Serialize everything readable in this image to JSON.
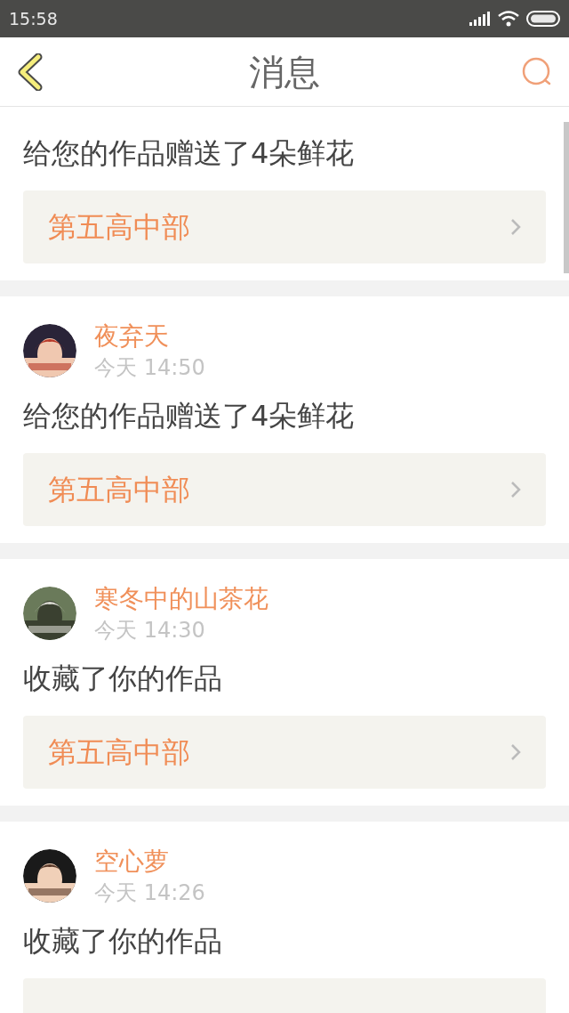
{
  "status_bar": {
    "time": "15:58"
  },
  "header": {
    "title": "消息"
  },
  "messages": [
    {
      "text": "给您的作品赠送了4朵鲜花",
      "link": "第五高中部"
    },
    {
      "author": "夜弃天",
      "time": "今天 14:50",
      "text": "给您的作品赠送了4朵鲜花",
      "link": "第五高中部"
    },
    {
      "author": "寒冬中的山茶花",
      "time": "今天 14:30",
      "text": "收藏了你的作品",
      "link": "第五高中部"
    },
    {
      "author": "空心萝",
      "time": "今天 14:26",
      "text": "收藏了你的作品"
    }
  ]
}
